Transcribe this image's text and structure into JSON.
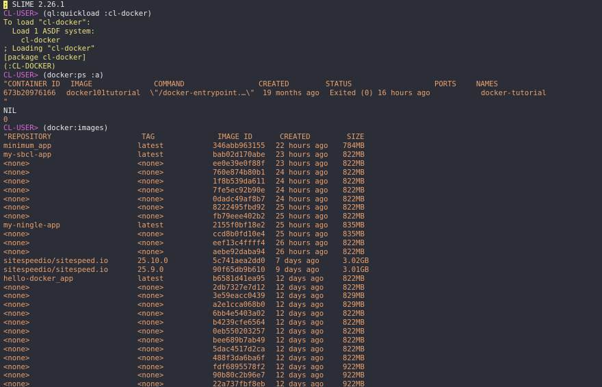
{
  "banner": {
    "cursor_char": ";",
    "text": " SLIME 2.26.1"
  },
  "prompt": "CL-USER>",
  "session1": {
    "command": " (ql:quickload :cl-docker)",
    "output": [
      "To load \"cl-docker\":",
      "  Load 1 ASDF system:",
      "    cl-docker",
      "; Loading \"cl-docker\"",
      "[package cl-docker]",
      "(:CL-DOCKER)"
    ]
  },
  "session2": {
    "command": " (docker:ps :a)",
    "headers": [
      "\"CONTAINER ID",
      "IMAGE",
      "COMMAND",
      "CREATED",
      "STATUS",
      "PORTS",
      "NAMES"
    ],
    "row": [
      "673b20976166",
      "docker101tutorial",
      "\\\"/docker-entrypoint.…\\\"",
      "19 months ago",
      "Exited (0) 16 hours ago",
      "",
      "docker-tutorial"
    ],
    "closing_quote": "\"",
    "results": [
      "NIL",
      "0"
    ]
  },
  "session3": {
    "command": " (docker:images)",
    "headers": [
      "\"REPOSITORY",
      "TAG",
      "IMAGE ID",
      "CREATED",
      "SIZE"
    ],
    "rows": [
      [
        "minimum_app",
        "latest",
        "346abb963155",
        "22 hours ago",
        "784MB"
      ],
      [
        "my-sbcl-app",
        "latest",
        "bab02d170abe",
        "23 hours ago",
        "822MB"
      ],
      [
        "<none>",
        "<none>",
        "ee0e39e0f88f",
        "23 hours ago",
        "822MB"
      ],
      [
        "<none>",
        "<none>",
        "760e874b80b1",
        "24 hours ago",
        "822MB"
      ],
      [
        "<none>",
        "<none>",
        "1f8b539da611",
        "24 hours ago",
        "822MB"
      ],
      [
        "<none>",
        "<none>",
        "7fe5ec92b90e",
        "24 hours ago",
        "822MB"
      ],
      [
        "<none>",
        "<none>",
        "0dadc49af8b7",
        "24 hours ago",
        "822MB"
      ],
      [
        "<none>",
        "<none>",
        "8222495fbd92",
        "25 hours ago",
        "822MB"
      ],
      [
        "<none>",
        "<none>",
        "fb79eee402b2",
        "25 hours ago",
        "822MB"
      ],
      [
        "my-ningle-app",
        "latest",
        "2155f0bf18e2",
        "25 hours ago",
        "835MB"
      ],
      [
        "<none>",
        "<none>",
        "ccd8b0fd10e4",
        "25 hours ago",
        "835MB"
      ],
      [
        "<none>",
        "<none>",
        "eef13c4ffff4",
        "26 hours ago",
        "822MB"
      ],
      [
        "<none>",
        "<none>",
        "aebe92daba94",
        "26 hours ago",
        "822MB"
      ],
      [
        "sitespeedio/sitespeed.io",
        "25.10.0",
        "5c741aea2dd0",
        "7 days ago",
        "3.02GB"
      ],
      [
        "sitespeedio/sitespeed.io",
        "25.9.0",
        "90f65db9b610",
        "9 days ago",
        "3.01GB"
      ],
      [
        "hello-docker_app",
        "latest",
        "b6581d41ea95",
        "12 days ago",
        "822MB"
      ],
      [
        "<none>",
        "<none>",
        "2db7327e7d12",
        "12 days ago",
        "822MB"
      ],
      [
        "<none>",
        "<none>",
        "3e59eacc0439",
        "12 days ago",
        "829MB"
      ],
      [
        "<none>",
        "<none>",
        "a2e1cca068b0",
        "12 days ago",
        "829MB"
      ],
      [
        "<none>",
        "<none>",
        "6bb4e5403a02",
        "12 days ago",
        "822MB"
      ],
      [
        "<none>",
        "<none>",
        "b4239cfe6564",
        "12 days ago",
        "822MB"
      ],
      [
        "<none>",
        "<none>",
        "0eb550203257",
        "12 days ago",
        "822MB"
      ],
      [
        "<none>",
        "<none>",
        "bee689b7ab49",
        "12 days ago",
        "822MB"
      ],
      [
        "<none>",
        "<none>",
        "5dac4517d2ca",
        "12 days ago",
        "822MB"
      ],
      [
        "<none>",
        "<none>",
        "488f3da6ba6f",
        "12 days ago",
        "822MB"
      ],
      [
        "<none>",
        "<none>",
        "fdf6895578f2",
        "12 days ago",
        "922MB"
      ],
      [
        "<none>",
        "<none>",
        "90b80c2b96e7",
        "12 days ago",
        "922MB"
      ],
      [
        "<none>",
        "<none>",
        "22a737fbf8eb",
        "12 days ago",
        "922MB"
      ]
    ]
  },
  "colors": {
    "background": "#2b2d37",
    "banner_text": "#e6e6e6",
    "prompt": "#d667d6",
    "input": "#e6e6e6",
    "output": "#e8df7e",
    "result": "#e6a06e",
    "cursor": "#f1ef6a"
  }
}
